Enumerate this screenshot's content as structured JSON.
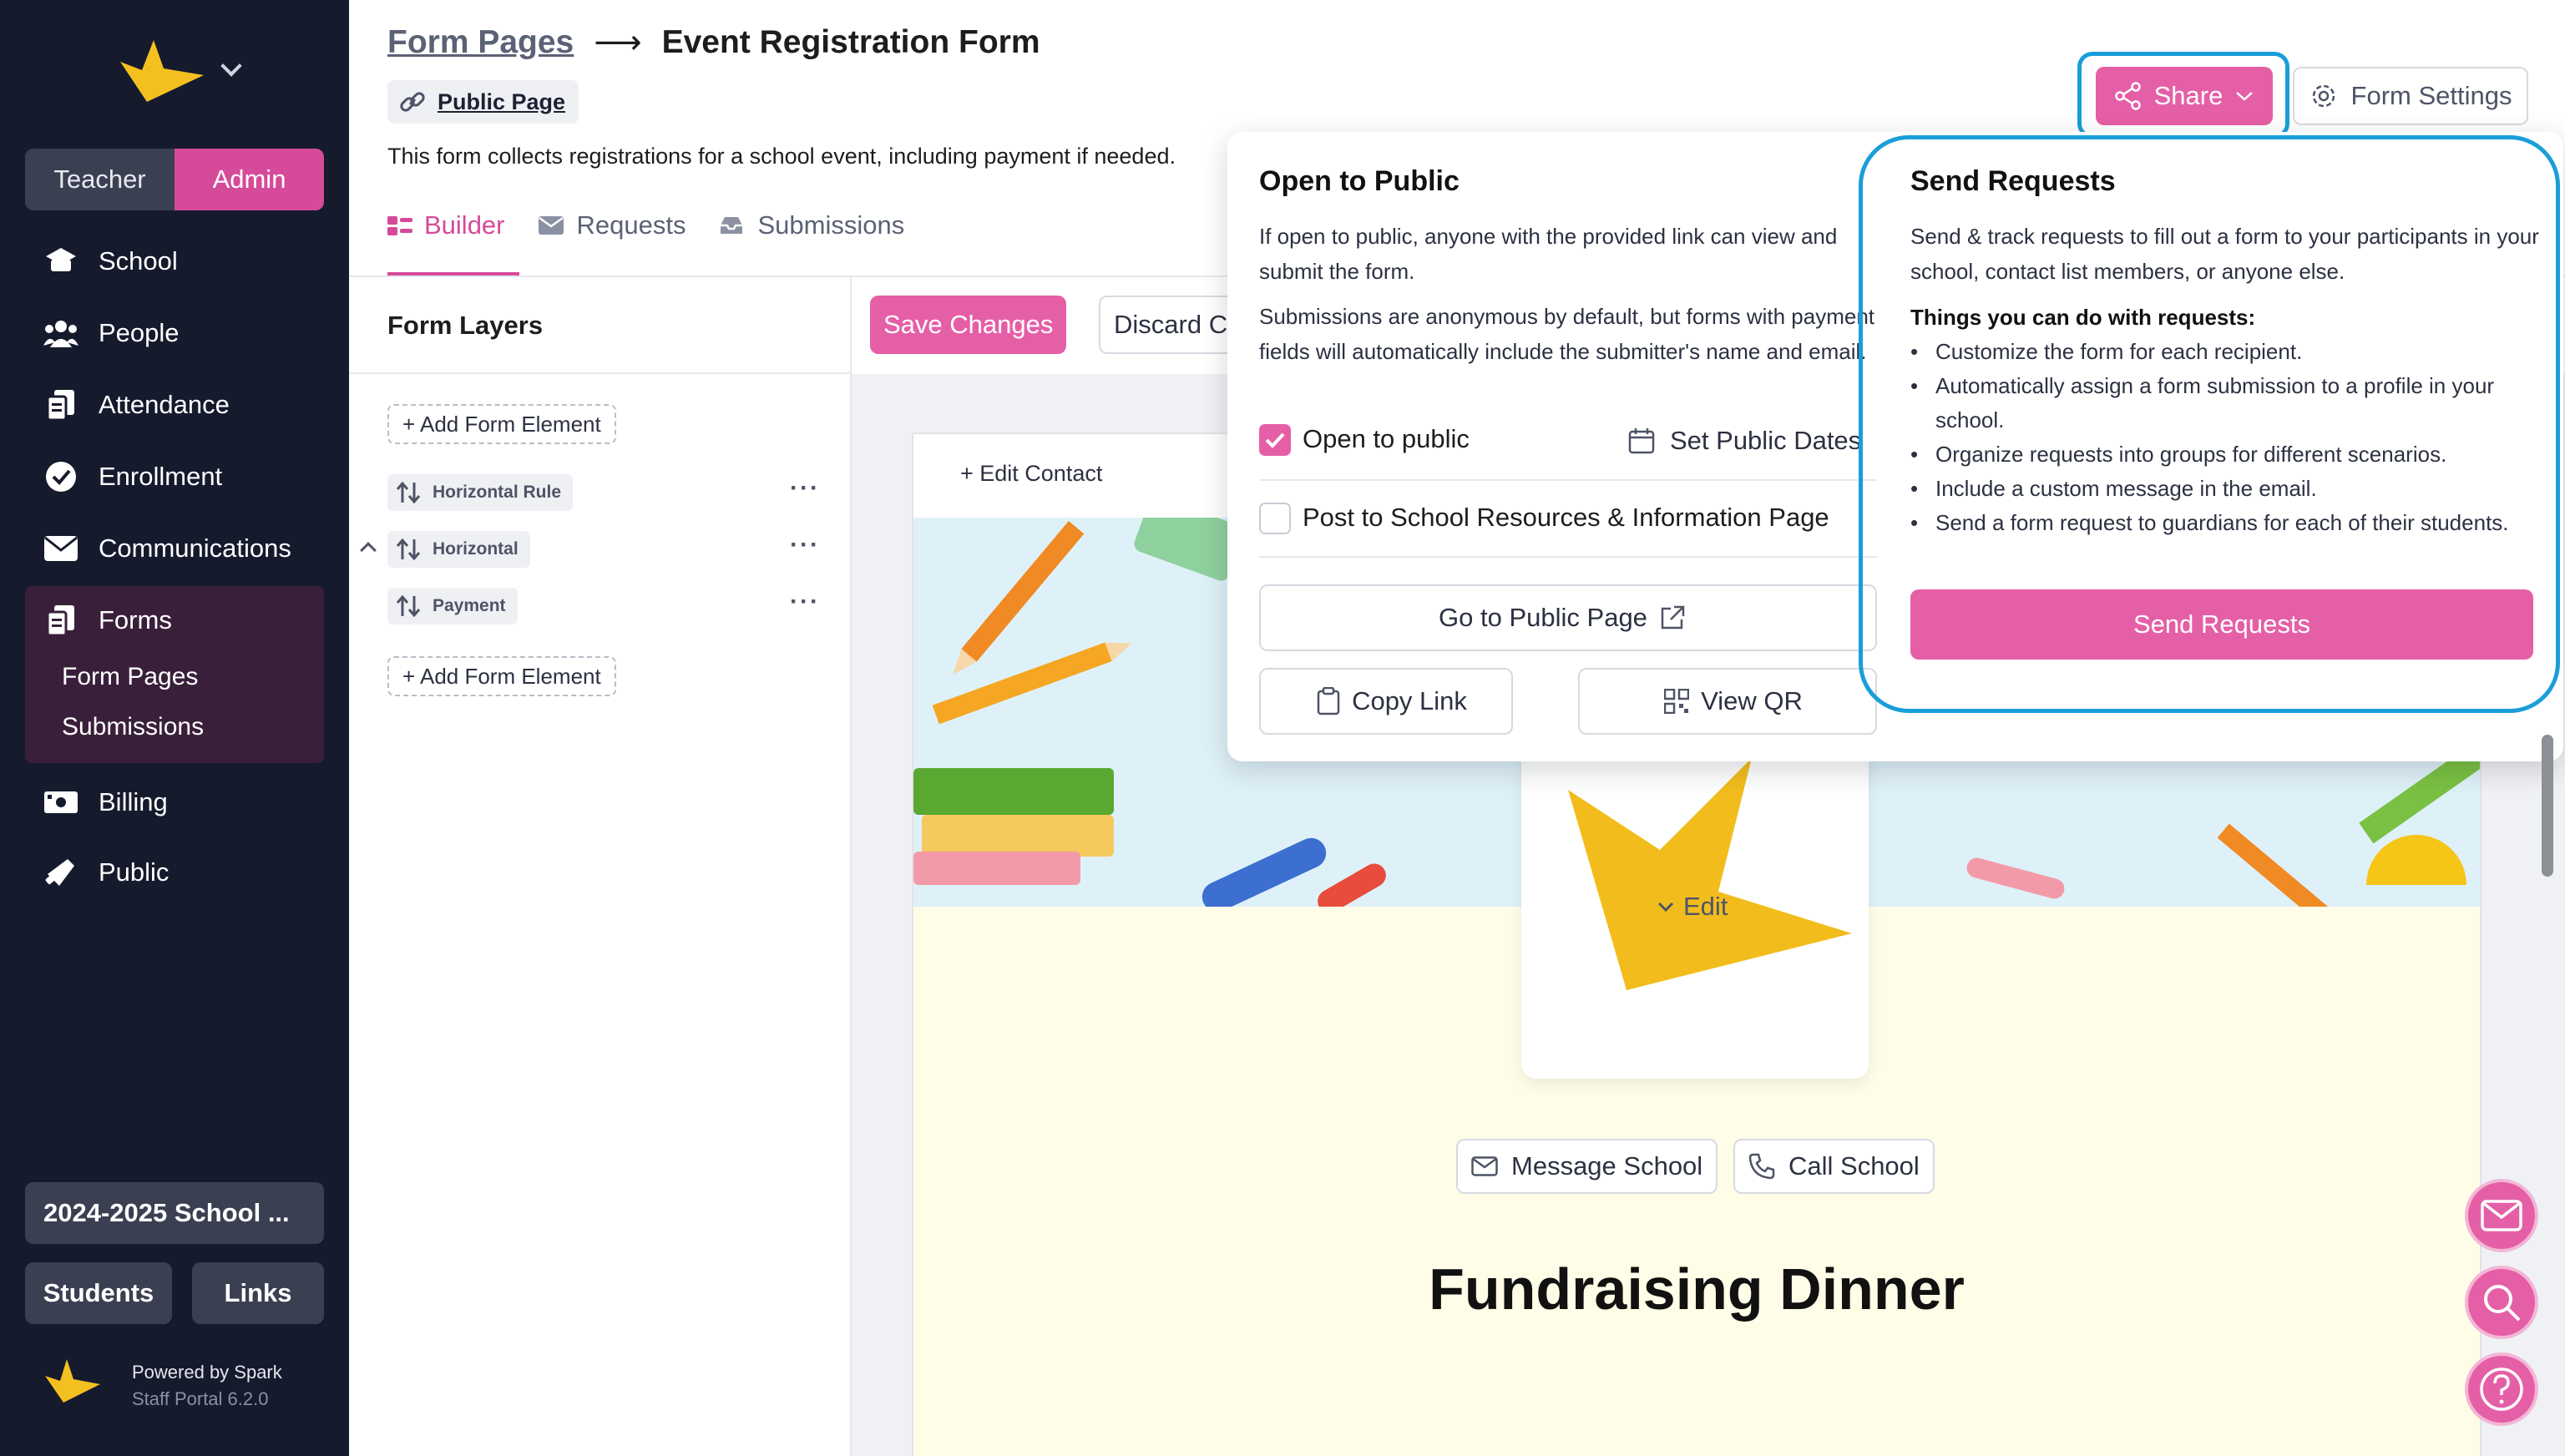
{
  "sidebar": {
    "roles": [
      "Teacher",
      "Admin"
    ],
    "items": [
      {
        "label": "School",
        "icon": "school-cap-icon"
      },
      {
        "label": "People",
        "icon": "people-icon"
      },
      {
        "label": "Attendance",
        "icon": "attendance-icon"
      },
      {
        "label": "Enrollment",
        "icon": "check-badge-icon"
      },
      {
        "label": "Communications",
        "icon": "envelope-icon"
      },
      {
        "label": "Forms",
        "icon": "forms-icon"
      },
      {
        "label": "Billing",
        "icon": "billing-icon"
      },
      {
        "label": "Public",
        "icon": "megaphone-icon"
      }
    ],
    "forms_sub": [
      "Form Pages",
      "Submissions"
    ],
    "year": "2024-2025 School ...",
    "students": "Students",
    "links": "Links",
    "powered": "Powered by Spark",
    "version": "Staff Portal 6.2.0"
  },
  "header": {
    "crumb_link": "Form Pages",
    "arrow": "⟶",
    "title": "Event Registration Form",
    "public_page": "Public Page",
    "description": "This form collects registrations for a school event, including payment if needed.",
    "tabs": [
      "Builder",
      "Requests",
      "Submissions"
    ],
    "share": "Share",
    "form_settings": "Form Settings"
  },
  "layers": {
    "title": "Form Layers",
    "add": "+ Add Form Element",
    "items": [
      "Horizontal Rule",
      "Horizontal",
      "Payment"
    ]
  },
  "toolbar": {
    "save": "Save Changes",
    "discard": "Discard Changes"
  },
  "canvas": {
    "edit_contact": "+ Edit Contact",
    "edit": "Edit",
    "message_school": "Message School",
    "call_school": "Call School",
    "title": "Fundraising Dinner"
  },
  "popover": {
    "public_title": "Open to Public",
    "public_p1": "If open to public, anyone with the provided link can view and submit the form.",
    "public_p2": "Submissions are anonymous by default, but forms with payment fields will automatically include the submitter's name and email.",
    "open_public": "Open to public",
    "set_dates": "Set Public Dates",
    "post_resources": "Post to School Resources & Information Page",
    "go_public": "Go to Public Page",
    "copy_link": "Copy Link",
    "view_qr": "View QR",
    "send_title": "Send Requests",
    "send_p": "Send & track requests to fill out a form to your participants in your school, contact list members, or anyone else.",
    "things_title": "Things you can do with requests:",
    "things": [
      "Customize the form for each recipient.",
      "Automatically assign a form submission to a profile in your school.",
      "Organize requests into groups for different scenarios.",
      "Include a custom message in the email.",
      "Send a form request to guardians for each of their students."
    ],
    "send_button": "Send Requests"
  },
  "colors": {
    "brand_pink": "#e55fa6",
    "sidebar_bg": "#151a2d",
    "highlight_blue": "#1a9ed9"
  }
}
